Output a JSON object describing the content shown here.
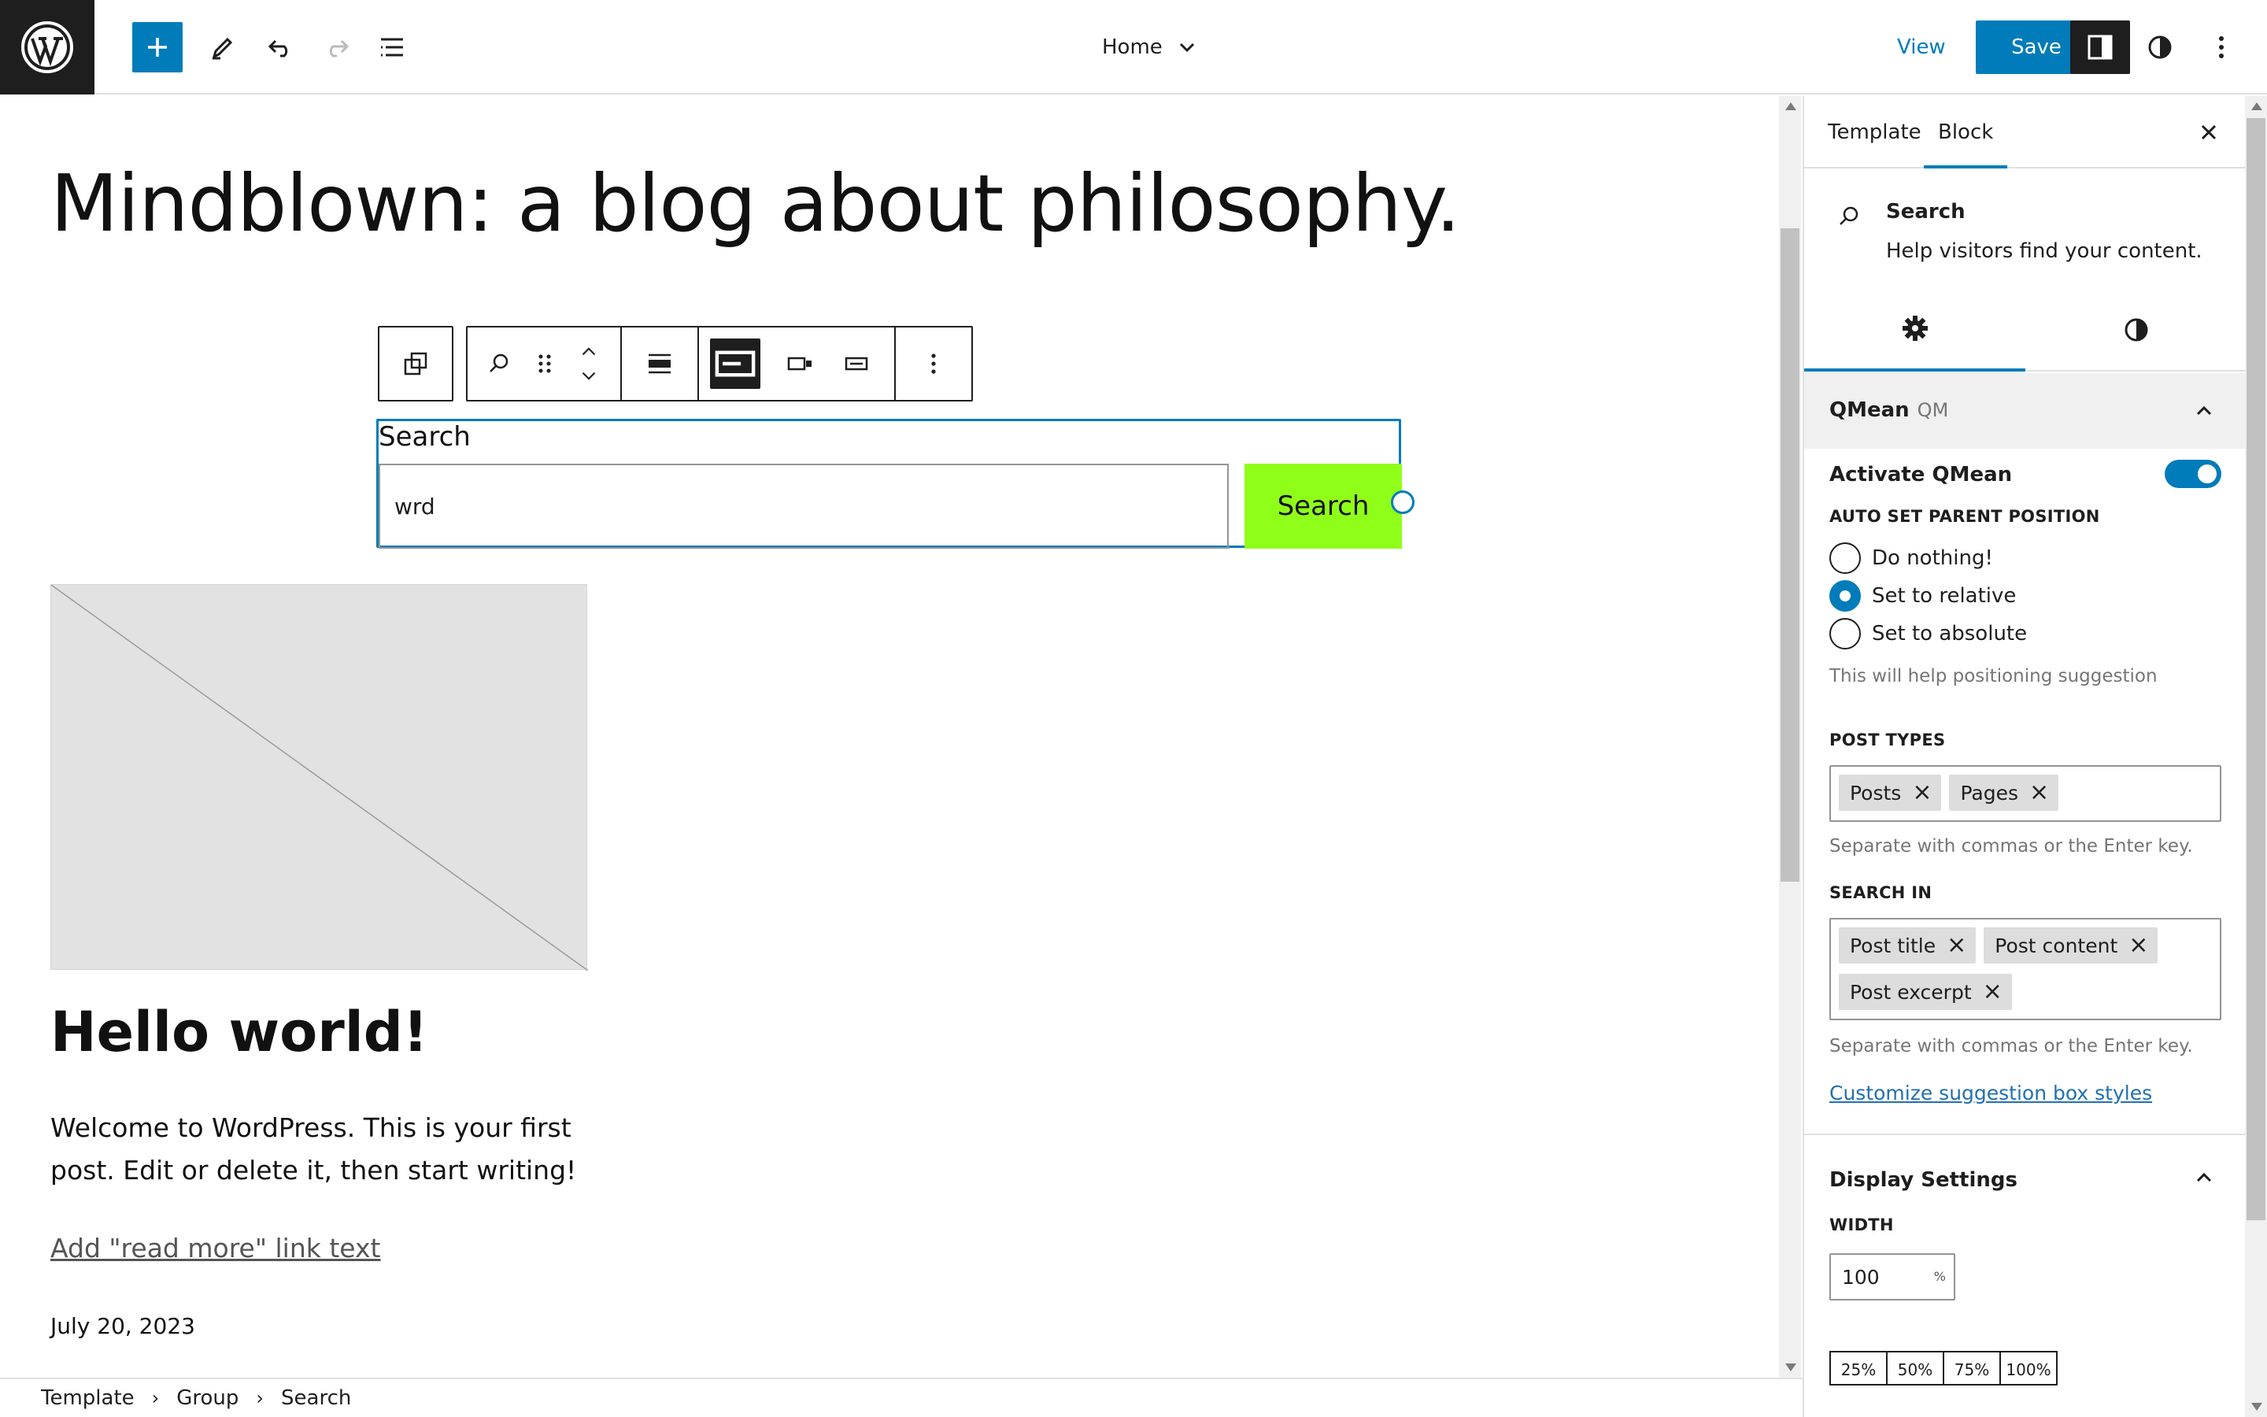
{
  "header": {
    "document_title": "Home",
    "view_label": "View",
    "save_label": "Save"
  },
  "canvas": {
    "site_title": "Mindblown: a blog about philosophy.",
    "search_block": {
      "label": "Search",
      "input_value": "wrd",
      "button_label": "Search",
      "button_color": "#8fff1a"
    },
    "post": {
      "title": "Hello world!",
      "excerpt": "Welcome to WordPress. This is your first post. Edit or delete it, then start writing!",
      "read_more": "Add \"read more\" link text",
      "date": "July 20, 2023"
    }
  },
  "breadcrumb": [
    "Template",
    "Group",
    "Search"
  ],
  "sidebar": {
    "tabs": [
      "Template",
      "Block"
    ],
    "active_tab": "Block",
    "block_card": {
      "title": "Search",
      "description": "Help visitors find your content."
    },
    "qmean": {
      "title": "QMean",
      "badge": "QM",
      "activate_label": "Activate QMean",
      "activated": true,
      "auto_parent_label": "AUTO SET PARENT POSITION",
      "options": [
        "Do nothing!",
        "Set to relative",
        "Set to absolute"
      ],
      "selected_option": "Set to relative",
      "positioning_help": "This will help positioning suggestion",
      "post_types_label": "POST TYPES",
      "post_types": [
        "Posts",
        "Pages"
      ],
      "post_types_help": "Separate with commas or the Enter key.",
      "search_in_label": "SEARCH IN",
      "search_in": [
        "Post title",
        "Post content",
        "Post excerpt"
      ],
      "search_in_help": "Separate with commas or the Enter key.",
      "customize_link": "Customize suggestion box styles"
    },
    "display": {
      "title": "Display Settings",
      "width_label": "WIDTH",
      "width_value": "100",
      "width_unit": "%",
      "percent_options": [
        "25%",
        "50%",
        "75%",
        "100%"
      ]
    }
  },
  "colors": {
    "accent": "#007cba",
    "dark": "#1e1e1e"
  }
}
